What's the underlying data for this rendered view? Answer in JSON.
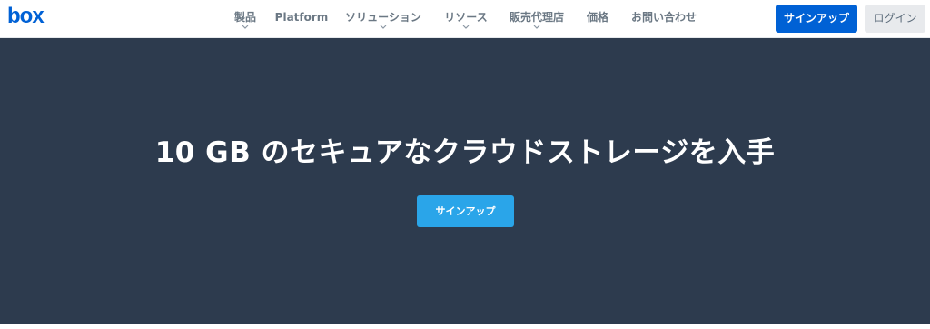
{
  "brand": {
    "logo_text": "box",
    "logo_color": "#0061d5"
  },
  "nav": {
    "items": [
      {
        "label": "製品",
        "has_dropdown": true
      },
      {
        "label": "Platform",
        "has_dropdown": false
      },
      {
        "label": "ソリューション",
        "has_dropdown": true
      },
      {
        "label": "リソース",
        "has_dropdown": true
      },
      {
        "label": "販売代理店",
        "has_dropdown": true
      },
      {
        "label": "価格",
        "has_dropdown": false
      },
      {
        "label": "お問い合わせ",
        "has_dropdown": false
      }
    ],
    "signup_label": "サインアップ",
    "login_label": "ログイン"
  },
  "hero": {
    "title": "10 GB のセキュアなクラウドストレージを入手",
    "cta_label": "サインアップ",
    "background_color": "#2d3b4e",
    "cta_color": "#2aa5e9"
  },
  "colors": {
    "primary_button": "#0061d5",
    "nav_text": "#6b7884"
  }
}
